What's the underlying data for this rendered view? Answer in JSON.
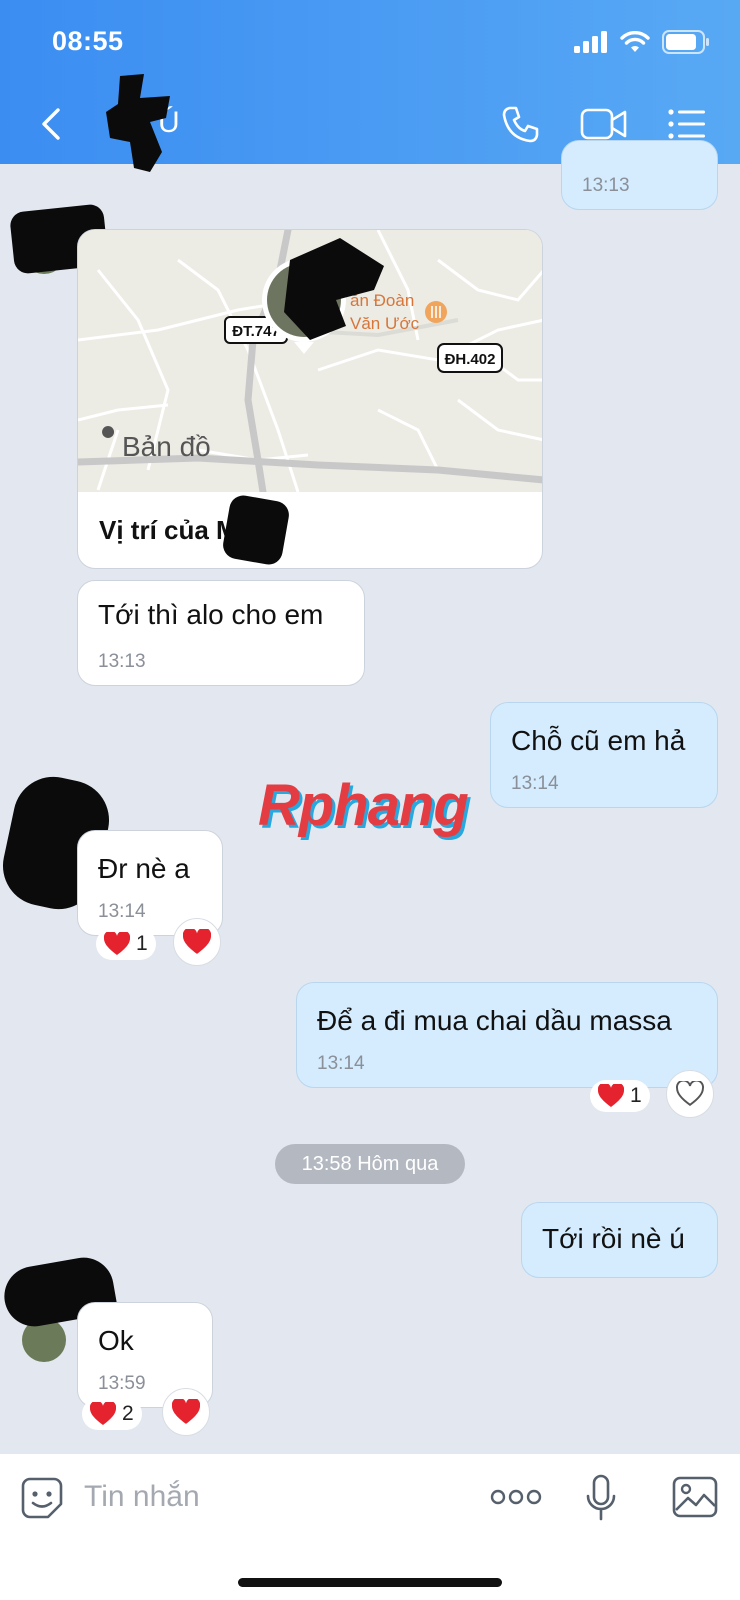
{
  "status_bar": {
    "time": "08:55"
  },
  "header": {
    "contact_name": "Mo Ú"
  },
  "messages": {
    "prev_time": "13:13",
    "location": {
      "road_label_1": "ĐT.747",
      "road_label_2": "ĐH.402",
      "poi_line_1": "ăn Đoàn",
      "poi_line_2": "Văn Ước",
      "map_brand": "Bản đồ",
      "caption": "Vị trí của Mo Ú"
    },
    "m1": {
      "text": "Tới thì alo cho em",
      "time": "13:13"
    },
    "m2": {
      "text": "Chỗ cũ em hả",
      "time": "13:14"
    },
    "m3": {
      "text": "Đr nè a",
      "time": "13:14",
      "reaction_count": "1"
    },
    "m4": {
      "text": "Để a đi mua chai dầu massa",
      "time": "13:14",
      "reaction_count": "1"
    },
    "date_separator": "13:58 Hôm qua",
    "m5": {
      "text": "Tới rồi  nè ú"
    },
    "m6": {
      "text": "Ok",
      "time": "13:59",
      "reaction_count": "2"
    }
  },
  "watermark": "Rphang",
  "composer": {
    "placeholder": "Tin nhắn"
  },
  "colors": {
    "header_start": "#3b8df2",
    "header_end": "#58a9f4",
    "outgoing_bubble": "#d4ecfe",
    "background": "#e3e7ef",
    "heart": "#e5232e"
  }
}
